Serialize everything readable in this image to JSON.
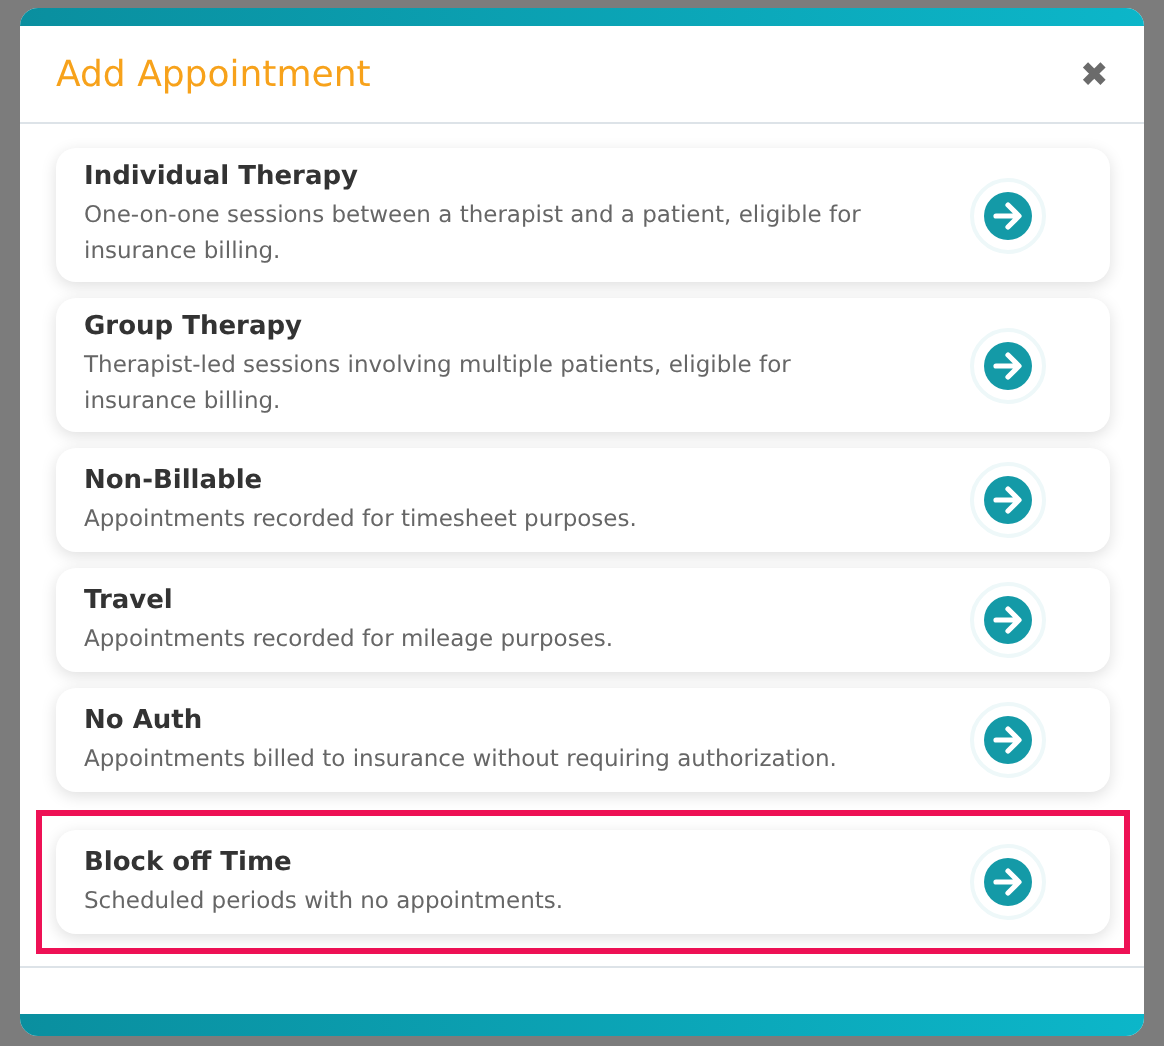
{
  "dialog": {
    "title": "Add Appointment",
    "close": "✖"
  },
  "options": [
    {
      "title": "Individual Therapy",
      "description": "One-on-one sessions between a therapist and a patient, eligible for insurance billing.",
      "highlighted": false
    },
    {
      "title": "Group Therapy",
      "description": "Therapist-led sessions involving multiple patients, eligible for insurance billing.",
      "highlighted": false
    },
    {
      "title": "Non-Billable",
      "description": "Appointments recorded for timesheet purposes.",
      "highlighted": false
    },
    {
      "title": "Travel",
      "description": "Appointments recorded for mileage purposes.",
      "highlighted": false
    },
    {
      "title": "No Auth",
      "description": "Appointments billed to insurance without requiring authorization.",
      "highlighted": false
    },
    {
      "title": "Block off Time",
      "description": "Scheduled periods with no appointments.",
      "highlighted": true
    }
  ]
}
